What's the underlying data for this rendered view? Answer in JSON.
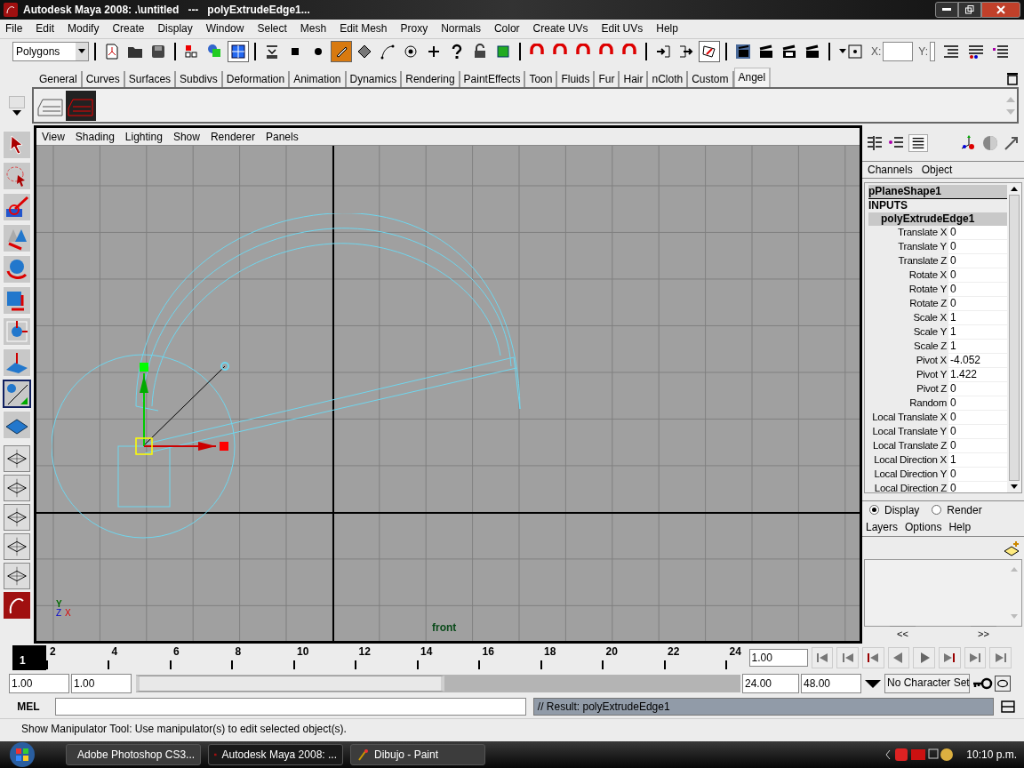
{
  "window": {
    "title": "Autodesk Maya 2008: .\\untitled   ---   polyExtrudeEdge1..."
  },
  "menus": [
    "File",
    "Edit",
    "Modify",
    "Create",
    "Display",
    "Window",
    "Select",
    "Mesh",
    "Edit Mesh",
    "Proxy",
    "Normals",
    "Color",
    "Create UVs",
    "Edit UVs",
    "Help"
  ],
  "status_line": {
    "mode": "Polygons",
    "x_label": "X:",
    "y_label": "Y:",
    "tools": [
      {
        "kind": "new",
        "on": false
      },
      {
        "kind": "open",
        "on": false
      },
      {
        "kind": "save",
        "on": false
      },
      {
        "kind": "sep"
      },
      {
        "kind": "hierarchy",
        "on": false
      },
      {
        "kind": "object",
        "on": false
      },
      {
        "kind": "component",
        "on": true
      },
      {
        "kind": "sep"
      },
      {
        "kind": "dropdown",
        "on": false
      },
      {
        "kind": "square",
        "on": false
      },
      {
        "kind": "dot",
        "on": false
      },
      {
        "kind": "pencil",
        "on": true
      },
      {
        "kind": "diamond",
        "on": false
      },
      {
        "kind": "curve",
        "on": false
      },
      {
        "kind": "target",
        "on": false
      },
      {
        "kind": "plus",
        "on": false
      },
      {
        "kind": "question",
        "on": false
      },
      {
        "kind": "lock",
        "on": false
      },
      {
        "kind": "grid",
        "on": false
      },
      {
        "kind": "sep"
      },
      {
        "kind": "magnet",
        "on": false
      },
      {
        "kind": "magnet",
        "on": false
      },
      {
        "kind": "magnet",
        "on": false
      },
      {
        "kind": "magnet",
        "on": false
      },
      {
        "kind": "magnet",
        "on": false
      },
      {
        "kind": "sep"
      },
      {
        "kind": "input",
        "on": false
      },
      {
        "kind": "output",
        "on": false
      },
      {
        "kind": "history",
        "on": true
      },
      {
        "kind": "sep"
      },
      {
        "kind": "render",
        "on": false
      },
      {
        "kind": "clapper",
        "on": false
      },
      {
        "kind": "ipr",
        "on": false
      },
      {
        "kind": "clapper",
        "on": false
      },
      {
        "kind": "sep"
      },
      {
        "kind": "snapbox",
        "on": false
      }
    ]
  },
  "shelf_tabs": [
    {
      "label": "General",
      "selected": false
    },
    {
      "label": "Curves",
      "selected": false
    },
    {
      "label": "Surfaces",
      "selected": false
    },
    {
      "label": "Subdivs",
      "selected": false
    },
    {
      "label": "Deformation",
      "selected": false
    },
    {
      "label": "Animation",
      "selected": false
    },
    {
      "label": "Dynamics",
      "selected": false
    },
    {
      "label": "Rendering",
      "selected": false
    },
    {
      "label": "PaintEffects",
      "selected": false
    },
    {
      "label": "Toon",
      "selected": false
    },
    {
      "label": "Fluids",
      "selected": false
    },
    {
      "label": "Fur",
      "selected": false
    },
    {
      "label": "Hair",
      "selected": false
    },
    {
      "label": "nCloth",
      "selected": false
    },
    {
      "label": "Custom",
      "selected": false
    },
    {
      "label": "Angel",
      "selected": true
    }
  ],
  "toolbox": [
    {
      "kind": "select",
      "selected": false
    },
    {
      "kind": "lasso",
      "selected": false
    },
    {
      "kind": "paint",
      "selected": false
    },
    {
      "kind": "move",
      "selected": false
    },
    {
      "kind": "rotate",
      "selected": false
    },
    {
      "kind": "scale",
      "selected": false
    },
    {
      "kind": "universal",
      "selected": false
    },
    {
      "kind": "soft",
      "selected": false
    },
    {
      "kind": "manipulator",
      "selected": true
    },
    {
      "kind": "last",
      "selected": false
    }
  ],
  "viewport": {
    "menus": [
      "View",
      "Shading",
      "Lighting",
      "Show",
      "Renderer",
      "Panels"
    ],
    "camera": "front",
    "axis": {
      "y": "Y",
      "z": "Z",
      "x": "X"
    }
  },
  "channel_box": {
    "menus": [
      "Channels",
      "Object"
    ],
    "node": "pPlaneShape1",
    "section": "INPUTS",
    "input": "polyExtrudeEdge1",
    "attributes": [
      {
        "name": "Translate X",
        "value": "0"
      },
      {
        "name": "Translate Y",
        "value": "0"
      },
      {
        "name": "Translate Z",
        "value": "0"
      },
      {
        "name": "Rotate X",
        "value": "0"
      },
      {
        "name": "Rotate Y",
        "value": "0"
      },
      {
        "name": "Rotate Z",
        "value": "0"
      },
      {
        "name": "Scale X",
        "value": "1"
      },
      {
        "name": "Scale Y",
        "value": "1"
      },
      {
        "name": "Scale Z",
        "value": "1"
      },
      {
        "name": "Pivot X",
        "value": "-4.052"
      },
      {
        "name": "Pivot Y",
        "value": "1.422"
      },
      {
        "name": "Pivot Z",
        "value": "0"
      },
      {
        "name": "Random",
        "value": "0"
      },
      {
        "name": "Local Translate X",
        "value": "0"
      },
      {
        "name": "Local Translate Y",
        "value": "0"
      },
      {
        "name": "Local Translate Z",
        "value": "0"
      },
      {
        "name": "Local Direction X",
        "value": "1"
      },
      {
        "name": "Local Direction Y",
        "value": "0"
      },
      {
        "name": "Local Direction Z",
        "value": "0"
      }
    ]
  },
  "layer_editor": {
    "modes": [
      {
        "label": "Display",
        "selected": true
      },
      {
        "label": "Render",
        "selected": false
      }
    ],
    "menus": [
      "Layers",
      "Options",
      "Help"
    ],
    "prev": "<<",
    "next": ">>"
  },
  "timeline": {
    "current": "1",
    "ticks": [
      "2",
      "4",
      "6",
      "8",
      "10",
      "12",
      "14",
      "16",
      "18",
      "20",
      "22",
      "24"
    ],
    "current_time": "1.00"
  },
  "range": {
    "level": 0.51,
    "start": "1.00",
    "playback_start": "1.00",
    "playback_end": "24.00",
    "end": "48.00",
    "character_set": "No Character Set"
  },
  "command_line": {
    "label": "MEL",
    "result": "// Result: polyExtrudeEdge1"
  },
  "help_line": "Show Manipulator Tool: Use manipulator(s) to edit selected object(s).",
  "taskbar": {
    "items": [
      {
        "label": "Adobe Photoshop CS3...",
        "kind": "photoshop",
        "selected": false
      },
      {
        "label": "Autodesk Maya 2008: ...",
        "kind": "maya",
        "selected": true
      },
      {
        "label": "Dibujo - Paint",
        "kind": "paint",
        "selected": false
      }
    ],
    "clock": "10:10 p.m."
  }
}
